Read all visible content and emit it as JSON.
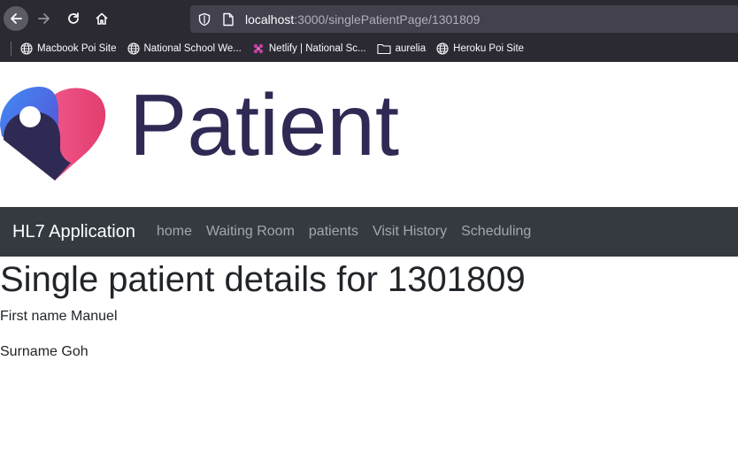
{
  "browser": {
    "url_host": "localhost",
    "url_path": ":3000/singlePatientPage/1301809",
    "bookmarks": [
      {
        "label": "Macbook Poi Site",
        "icon": "globe-icon"
      },
      {
        "label": "National School We...",
        "icon": "globe-icon"
      },
      {
        "label": "Netlify | National Sc...",
        "icon": "netlify-icon"
      },
      {
        "label": "aurelia",
        "icon": "folder-icon"
      },
      {
        "label": "Heroku Poi Site",
        "icon": "globe-icon"
      }
    ]
  },
  "logo": {
    "text": "Patient"
  },
  "navbar": {
    "brand": "HL7 Application",
    "links": [
      "home",
      "Waiting Room",
      "patients",
      "Visit History",
      "Scheduling"
    ]
  },
  "page": {
    "title": "Single patient details for 1301809",
    "first_name_line": "First name Manuel",
    "surname_line": "Surname Goh"
  },
  "colors": {
    "chrome_bg": "#2b2a33",
    "navbar_bg": "#343a40",
    "logo_text": "#2e2a54"
  }
}
